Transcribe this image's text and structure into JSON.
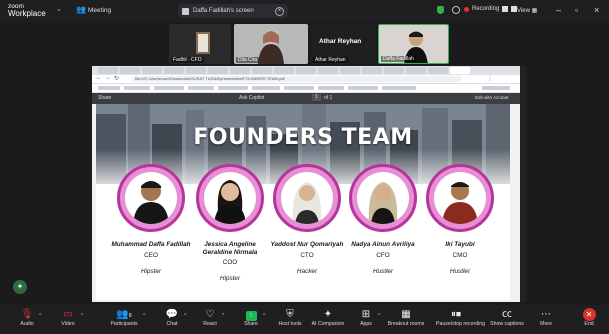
{
  "topbar": {
    "logo_small": "zoom",
    "logo_big": "Workplace",
    "meeting_label": "Meeting",
    "sharing_text": "Daffa Fadillah's screen",
    "recording_label": "Recording",
    "view_label": "View"
  },
  "thumbnails": [
    {
      "label": "Fadhil - CFO"
    },
    {
      "label": "Dila Cira"
    },
    {
      "label": "Athar Reyhan"
    },
    {
      "label": "Daffa Fadillah"
    }
  ],
  "thumbnail_center_name": "Athar Reyhan",
  "browser": {
    "url": "file:///C:/Users/user/Downloads/SURAT TUGAS/presentation/FOUNDERS TEAM.pdf",
    "pdf_left": "Share",
    "pdf_fit": "Ask Copilot",
    "pdf_page_num": "1",
    "pdf_page_total": "of 1",
    "pdf_right": "Edit with Acrobat"
  },
  "slide": {
    "title": "FOUNDERS TEAM",
    "members": [
      {
        "name": "Muhammad Daffa Fadillah",
        "role": "CEO",
        "type": "Hipster"
      },
      {
        "name": "Jessica Angeline Geraldine Nirmala",
        "role": "COO",
        "type": "Hipster"
      },
      {
        "name": "Yaddost Nur Qomariyah",
        "role": "CTO",
        "type": "Hacker"
      },
      {
        "name": "Nadya Ainun Avriliya",
        "role": "CFO",
        "type": "Hustler"
      },
      {
        "name": "Iki Tayubi",
        "role": "CMO",
        "type": "Hustler"
      }
    ]
  },
  "toolbar": {
    "audio": "Audio",
    "video": "Video",
    "participants": "Participants",
    "participants_count": "8",
    "chat": "Chat",
    "react": "React",
    "share": "Share",
    "host_tools": "Host tools",
    "ai_companion": "AI Companion",
    "apps": "Apps",
    "breakout_rooms": "Breakout rooms",
    "pause_recording": "Pause/stop recording",
    "show_captions": "Show captions",
    "more": "More",
    "end": "End"
  },
  "colors": {
    "accent_ring": "#b6359c",
    "ring_fill": "#e78fd4",
    "end_red": "#d9342b",
    "share_green": "#1db954"
  }
}
